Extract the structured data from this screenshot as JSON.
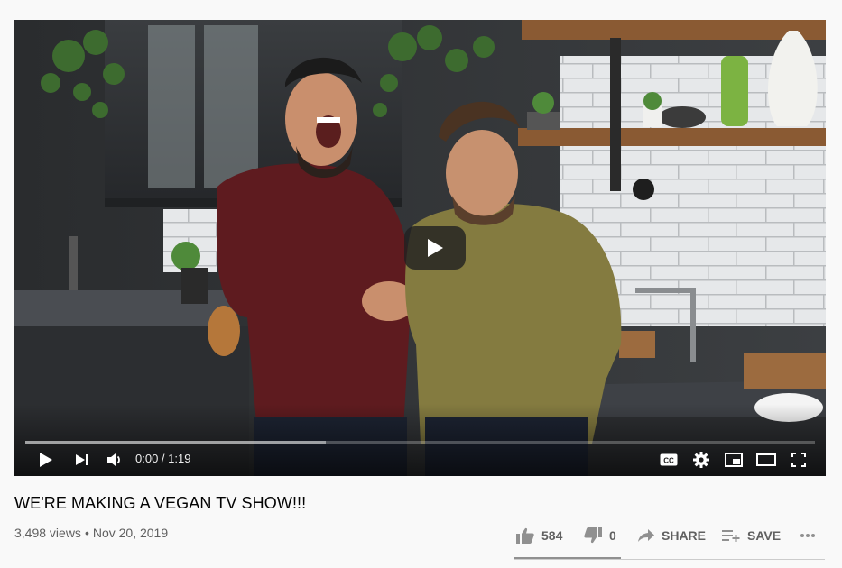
{
  "video": {
    "title": "WE'RE MAKING A VEGAN TV SHOW!!!",
    "views": "3,498 views",
    "separator": "•",
    "date": "Nov 20, 2019"
  },
  "player": {
    "time_current": "0:00",
    "time_separator": " / ",
    "time_total": "1:19",
    "played_fraction": 0.0,
    "loaded_fraction": 0.38,
    "accent_color": "#ff0000"
  },
  "actions": {
    "like_count": "584",
    "dislike_count": "0",
    "share_label": "SHARE",
    "save_label": "SAVE"
  },
  "icons": [
    "play-icon",
    "next-icon",
    "volume-icon",
    "captions-icon",
    "settings-icon",
    "miniplayer-icon",
    "theater-icon",
    "fullscreen-icon",
    "thumbs-up-icon",
    "thumbs-down-icon",
    "share-icon",
    "playlist-add-icon",
    "more-icon"
  ]
}
